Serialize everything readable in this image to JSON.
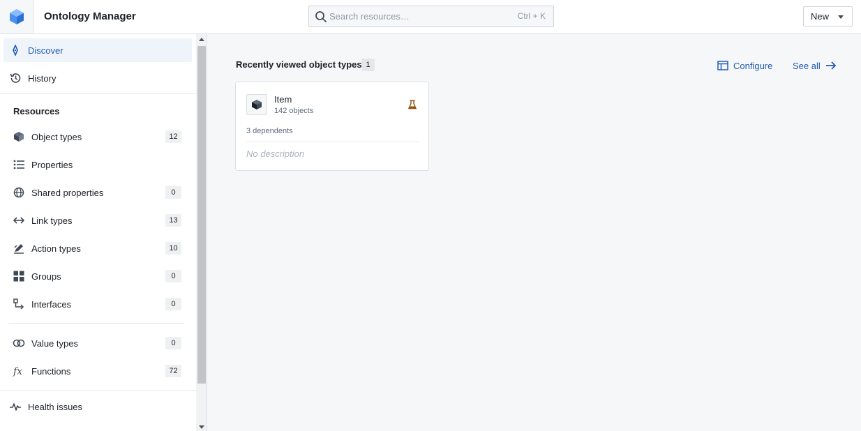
{
  "header": {
    "app_title": "Ontology Manager",
    "search_placeholder": "Search resources…",
    "search_shortcut": "Ctrl + K",
    "new_button": "New"
  },
  "sidebar": {
    "nav": [
      {
        "label": "Discover",
        "icon": "compass-icon",
        "active": true
      },
      {
        "label": "History",
        "icon": "history-icon",
        "active": false
      }
    ],
    "resources_title": "Resources",
    "resources": [
      {
        "label": "Object types",
        "icon": "cube-icon",
        "count": "12"
      },
      {
        "label": "Properties",
        "icon": "properties-list-icon",
        "count": ""
      },
      {
        "label": "Shared properties",
        "icon": "globe-icon",
        "count": "0"
      },
      {
        "label": "Link types",
        "icon": "arrows-horizontal-icon",
        "count": "13"
      },
      {
        "label": "Action types",
        "icon": "edit-action-icon",
        "count": "10"
      },
      {
        "label": "Groups",
        "icon": "grid-icon",
        "count": "0"
      },
      {
        "label": "Interfaces",
        "icon": "interface-icon",
        "count": "0"
      }
    ],
    "extras": [
      {
        "label": "Value types",
        "icon": "value-types-icon",
        "count": "0"
      },
      {
        "label": "Functions",
        "icon": "function-icon",
        "count": "72"
      }
    ],
    "footer": [
      {
        "label": "Health issues",
        "icon": "pulse-icon"
      }
    ]
  },
  "main": {
    "section_title": "Recently viewed object types",
    "section_count": "1",
    "configure_label": "Configure",
    "see_all_label": "See all",
    "cards": [
      {
        "name": "Item",
        "objects": "142 objects",
        "dependents": "3 dependents",
        "description": "No description",
        "badge_icon": "flask-icon",
        "badge_color": "#935610"
      }
    ]
  },
  "colors": {
    "accent": "#215db0",
    "active_bg": "#eff4fb",
    "logo_blue": "#2d72d2"
  }
}
